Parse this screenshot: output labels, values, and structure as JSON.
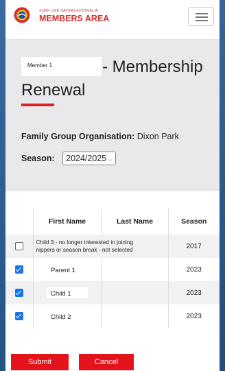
{
  "header": {
    "brand_small": "SURF LIFE SAVING AUSTRALIA",
    "brand_title": "MEMBERS AREA",
    "logo_icon": "surf-life-saving-logo",
    "menu_icon": "hamburger-icon"
  },
  "form": {
    "member_field_value": "Member 1",
    "title_part1": "- Membership",
    "title_part2": "Renewal",
    "family_label": "Family Group Organisation:",
    "family_value": "Dixon Park",
    "season_label": "Season:",
    "season_selected": "2024/2025"
  },
  "table": {
    "headers": [
      "",
      "First Name",
      "Last Name",
      "Season"
    ],
    "rows": [
      {
        "checked": false,
        "first_name": "Child 3 - no longer interested in joining",
        "first_name_line2": "nippers or season break - not selected",
        "last_name": "",
        "season": "2017"
      },
      {
        "checked": true,
        "first_name": "Parent 1",
        "last_name": "",
        "season": "2023"
      },
      {
        "checked": true,
        "first_name": "Child 1",
        "last_name": "",
        "season": "2023"
      },
      {
        "checked": true,
        "first_name": "Child 2",
        "last_name": "",
        "season": "2023"
      }
    ]
  },
  "actions": {
    "submit_label": "Submit",
    "cancel_label": "Cancel"
  },
  "colors": {
    "accent_red": "#e3121b",
    "checkbox_blue": "#1a73e8",
    "background_blue": "#2f5e93"
  }
}
